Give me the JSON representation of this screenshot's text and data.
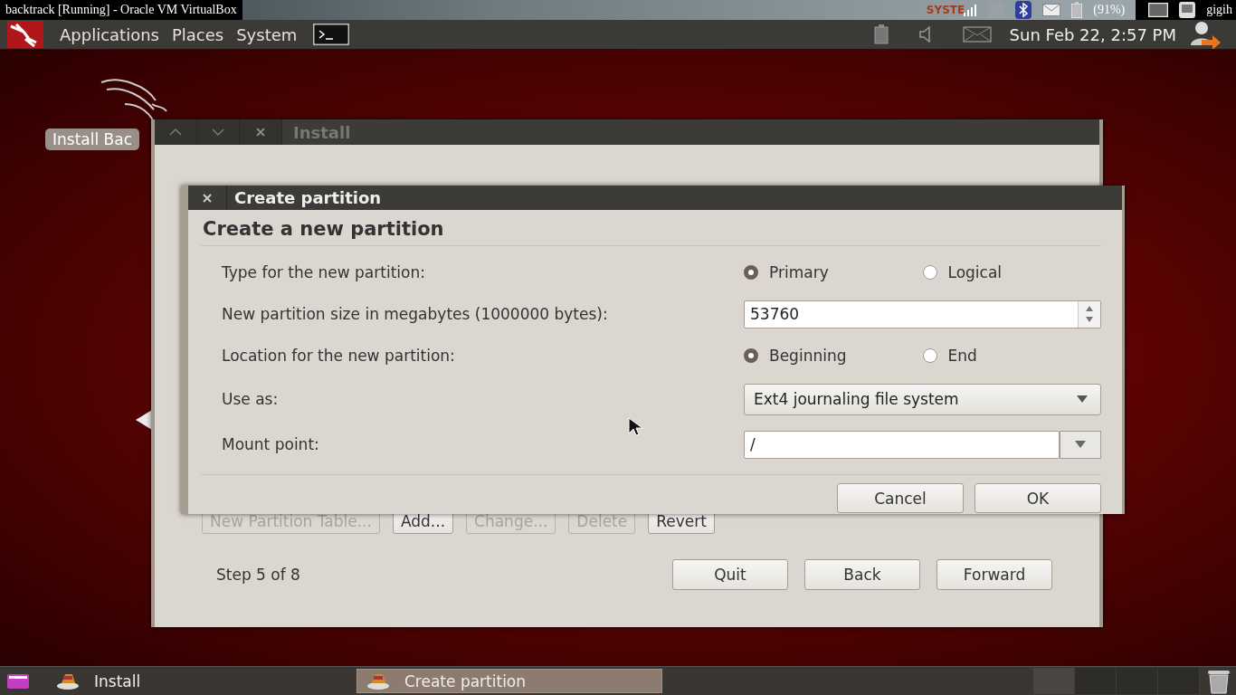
{
  "host_bar": {
    "title": "backtrack [Running] - Oracle VM VirtualBox",
    "widget_text": "SYSTE",
    "battery_reading": "(91%)",
    "user": "gigih"
  },
  "top_panel": {
    "menus": [
      "Applications",
      "Places",
      "System"
    ],
    "clock": "Sun Feb 22,  2:57 PM"
  },
  "desktop": {
    "icons": [
      {
        "label": "Install Bac"
      }
    ]
  },
  "install_window": {
    "title": "Install",
    "partition_buttons": [
      {
        "label": "New Partition Table...",
        "disabled": true
      },
      {
        "label": "Add...",
        "disabled": false
      },
      {
        "label": "Change...",
        "disabled": true
      },
      {
        "label": "Delete",
        "disabled": true
      },
      {
        "label": "Revert",
        "disabled": false
      }
    ],
    "step": "Step 5 of 8",
    "nav_buttons": [
      "Quit",
      "Back",
      "Forward"
    ]
  },
  "dialog": {
    "title": "Create partition",
    "heading": "Create a new partition",
    "rows": [
      {
        "kind": "radio",
        "label": "Type for the new partition:",
        "options": [
          {
            "label": "Primary",
            "selected": true
          },
          {
            "label": "Logical",
            "selected": false
          }
        ]
      },
      {
        "kind": "spin",
        "label": "New partition size in megabytes (1000000 bytes):",
        "value": "53760"
      },
      {
        "kind": "radio",
        "label": "Location for the new partition:",
        "options": [
          {
            "label": "Beginning",
            "selected": true
          },
          {
            "label": "End",
            "selected": false
          }
        ]
      },
      {
        "kind": "combo",
        "label": "Use as:",
        "value": "Ext4 journaling file system"
      },
      {
        "kind": "entry_combo",
        "label": "Mount point:",
        "value": "/"
      }
    ],
    "buttons": [
      "Cancel",
      "OK"
    ]
  },
  "taskbar": {
    "tasks": [
      {
        "label": "Install",
        "selected": false
      },
      {
        "label": "Create partition",
        "selected": true
      }
    ]
  }
}
